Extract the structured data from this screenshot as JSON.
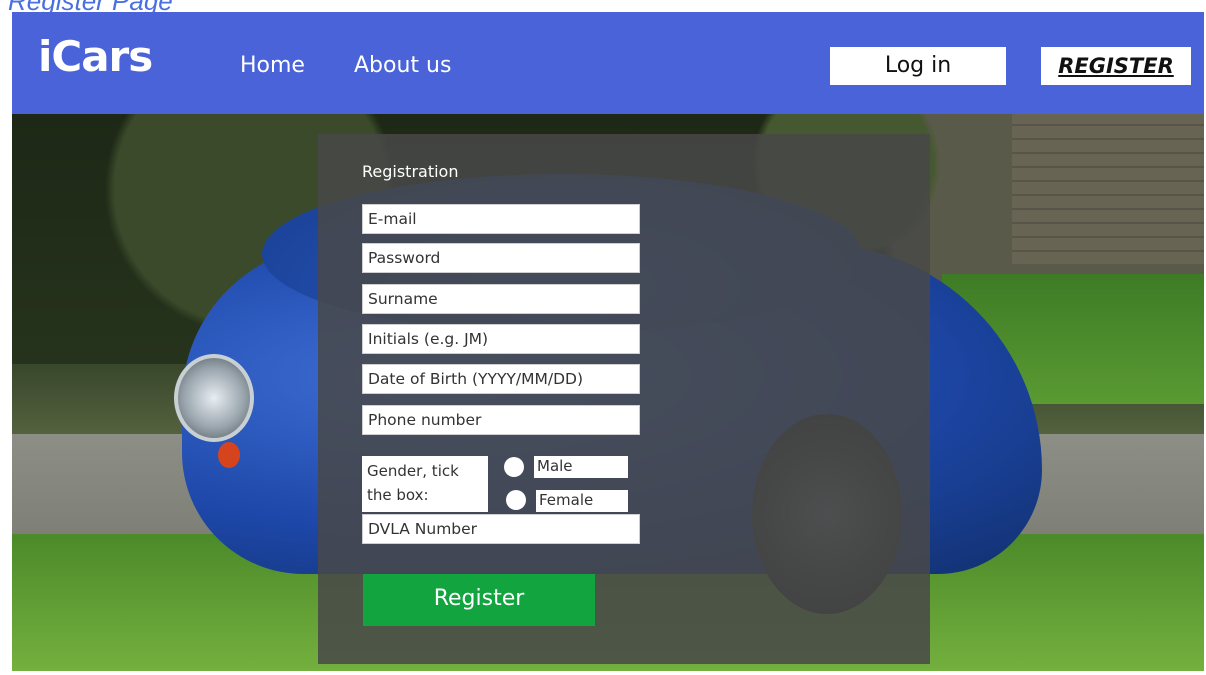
{
  "page": {
    "caption": "Register Page"
  },
  "header": {
    "logo": "iCars",
    "nav": {
      "home": "Home",
      "about": "About us"
    },
    "login_label": "Log in",
    "register_label": "REGISTER"
  },
  "form": {
    "title": "Registration",
    "fields": {
      "email": "E-mail",
      "password": "Password",
      "surname": "Surname",
      "initials": "Initials (e.g. JM)",
      "dob": "Date of Birth (YYYY/MM/DD)",
      "phone": "Phone number",
      "dvla": "DVLA Number"
    },
    "gender": {
      "label": "Gender, tick the box:",
      "options": {
        "male": "Male",
        "female": "Female"
      }
    },
    "submit_label": "Register"
  },
  "colors": {
    "header_bg": "#4a63d9",
    "panel_bg": "rgba(72,72,72,0.86)",
    "register_button": "#12a43f",
    "caption": "#4a6fe0"
  }
}
